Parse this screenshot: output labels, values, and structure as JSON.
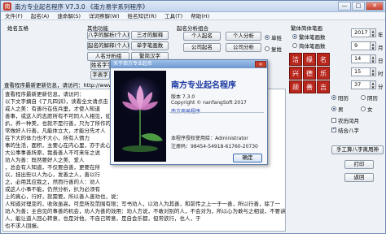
{
  "window": {
    "title": "南方专业起名程序  V7.3.0   《南方易学系列程序》",
    "min": "—",
    "max": "□",
    "close": "✕"
  },
  "menus": [
    "文件(F)",
    "起名(A)",
    "速命解(S)",
    "详词察解(W)",
    "姓名知识(R)",
    "工具(T)",
    "帮助(H)"
  ],
  "left": {
    "title": "姓名五格"
  },
  "center": {
    "group1_title": "其他功能",
    "btn_bazi": "八字的解析(个人)",
    "btn_sancai": "三才的解释",
    "btn_qiming": "起名的解释(个人)",
    "btn_danzi": "单字笔画数",
    "btn_rgfen": "人名分析组",
    "btn_fanjian": "繁简汉字",
    "btn_geren": "个人起名",
    "btn_gongsi": "公司起名",
    "btn_gerenfx": "个人分析",
    "btn_gongsifx": "公司分析",
    "group2_title": "起名分析组合",
    "radio_dan": "单姓",
    "radio_fu": "复姓",
    "label_xingming": "姓名字字",
    "label_zixing": "字表字",
    "url_line": "查看程序最新更新信息，请访问：http://www.nanfang.com"
  },
  "right": {
    "group_title": "繁体简体笔画",
    "radio_fan": "繁体笔画数",
    "radio_jian": "简体笔画数",
    "seals": [
      "洁",
      "缘",
      "名",
      "兴",
      "德",
      "乐",
      "颉",
      "善",
      "吉"
    ],
    "year": "2017",
    "month": "9",
    "day": "14",
    "hour": "15",
    "minute": "37",
    "year_u": "年",
    "month_u": "月",
    "day_u": "日",
    "hour_u": "时",
    "minute_u": "分",
    "radio_yangli": "阳历",
    "radio_yinli": "阴历",
    "radio_nan": "男",
    "radio_nv": "女",
    "chk_nongli": "农历闰月",
    "chk_jieqi": "结合八字",
    "btn_shougong": "手工算八字离用神",
    "btn_print": "打印",
    "btn_back": "返回"
  },
  "content": {
    "lines": [
      "查看程序最新更新信息，请访问：",
      "以下文字摘自《了凡四训》，读看全文请点击",
      "    戒人之美：有善行在伍兵里，才使人知道",
      "善事，或这人的志愿所有不可同人人相见，如能人行善，",
      "扒，养一种美，也就不是行善，只为了所作的心",
      "常做好人行善，凡能体立大，才能分先才人",
      "      在下大的体力也不大小，所有人情力",
      "事的生活，面积，主要心在内心里，亦于此心",
      "大公事事善所原，我善善人不可来年之说",
      "      劝人为善：既然要好人之美、爱人",
      "，总会有人知道，不仅要自善，更要在所",
      "以，挂出些以人为心，发善之人，善以行",
      "之，必用其应我之，然而行善的人：劝人",
      "或这人小事不能，仍然分析，扒为必须有",
      "上的真心，行好，就需要。所以善人善劝也，说：",
      "人知道对理变的，收效虽高，可是所及范围有限；写书劝人，以劝人为其善，和前传之上一于一善，所以行善，除了一",
      "劝人为善；主自见的事善的机会，劝人为善的效用：劝人方说，不敢对别的人，不会对为，所以心为敢与之相谈，不要讲为高善心，可",
      "人，能让道人回心转意，也是对他，不自己转意，是自会乐都，但常欲行，也人，于",
      "    也不求人回报。"
    ]
  },
  "about": {
    "bar_title": "关于南方专业起名",
    "close": "✕",
    "app_name": "南方专业起名程序",
    "version": "版本 7.3.0",
    "copyright": "Copyright © nanfangSoft 2017",
    "link": "南方周易程序",
    "authorized": "本程序授权使用给：Administrator",
    "reg_code": "注册码：98454-54918-61760-20730",
    "ok": "确定"
  }
}
